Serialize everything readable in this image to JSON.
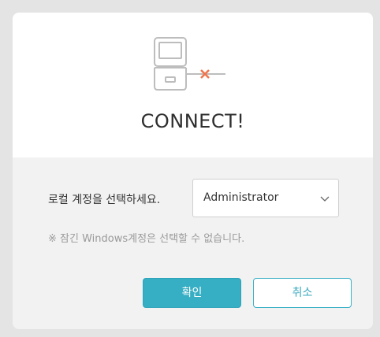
{
  "dialog": {
    "title": "CONNECT!",
    "account_label": "로컬 계정을 선택하세요.",
    "account_select": {
      "selected": "Administrator"
    },
    "notice": "※ 잠긴 Windows계정은 선택할 수 없습니다.",
    "ok_label": "확인",
    "cancel_label": "취소"
  },
  "colors": {
    "primary": "#36aec4",
    "disconnect_x": "#f0744c",
    "icon_stroke": "#bdbdbd"
  },
  "icons": {
    "illustration": "computer-disconnected-icon",
    "dropdown": "chevron-down-icon"
  }
}
